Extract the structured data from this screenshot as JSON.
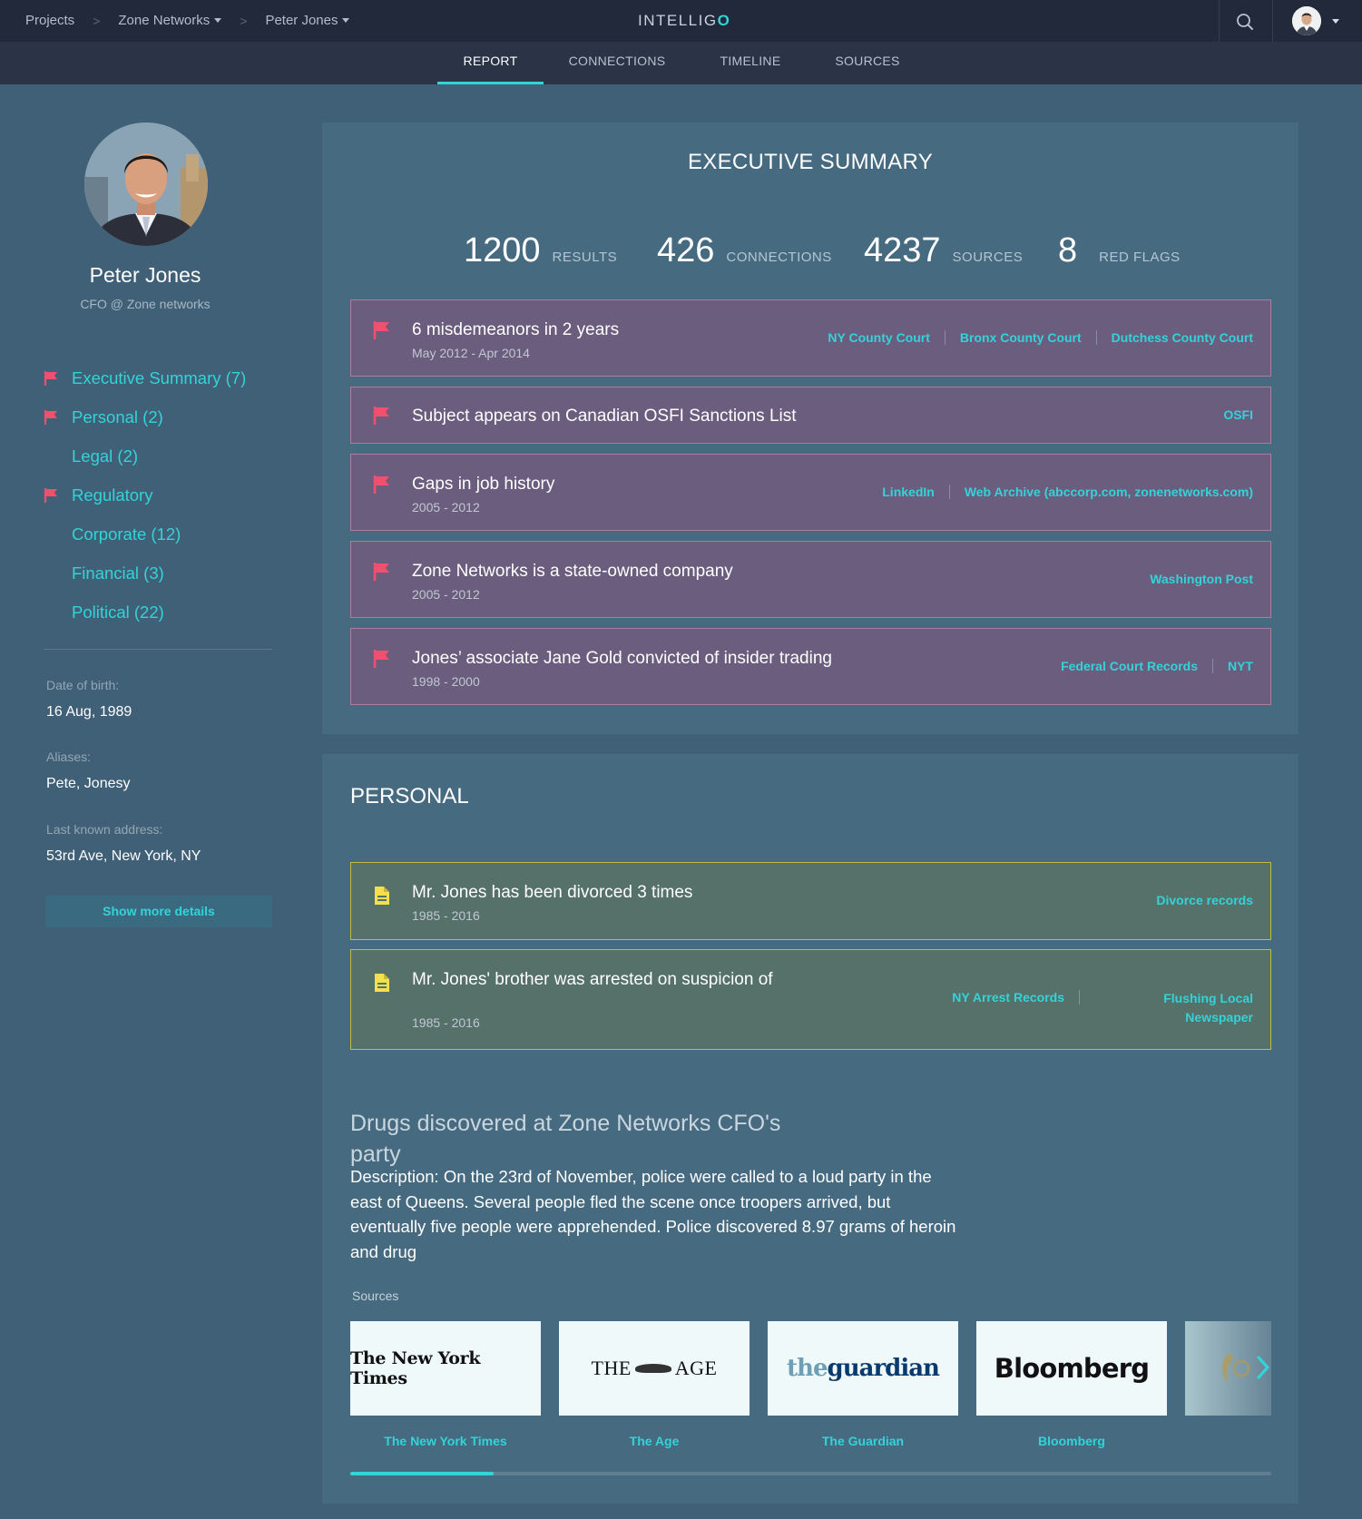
{
  "breadcrumb": {
    "items": [
      {
        "label": "Projects",
        "dropdown": false
      },
      {
        "label": "Zone Networks",
        "dropdown": true
      },
      {
        "label": "Peter Jones",
        "dropdown": true
      }
    ],
    "separator": ">"
  },
  "brand": {
    "prefix": "INTELLIG",
    "accent_letter": "O"
  },
  "header": {
    "search_icon": "search-icon",
    "avatar_icon": "user-avatar-icon"
  },
  "tabs": [
    {
      "label": "REPORT",
      "active": true
    },
    {
      "label": "CONNECTIONS",
      "active": false
    },
    {
      "label": "TIMELINE",
      "active": false
    },
    {
      "label": "SOURCES",
      "active": false
    }
  ],
  "profile": {
    "name": "Peter Jones",
    "role": "CFO @ Zone networks",
    "details": [
      {
        "label": "Date of birth:",
        "value": "16 Aug, 1989"
      },
      {
        "label": "Aliases:",
        "value": "Pete, Jonesy"
      },
      {
        "label": "Last known address:",
        "value": "53rd Ave, New York, NY"
      }
    ],
    "show_more_label": "Show more details"
  },
  "sidebar": {
    "items": [
      {
        "label": "Executive Summary (7)",
        "flagged": true
      },
      {
        "label": "Personal (2)",
        "flagged": true
      },
      {
        "label": "Legal (2)",
        "flagged": false
      },
      {
        "label": "Regulatory",
        "flagged": true
      },
      {
        "label": "Corporate (12)",
        "flagged": false
      },
      {
        "label": "Financial (3)",
        "flagged": false
      },
      {
        "label": "Political (22)",
        "flagged": false
      }
    ]
  },
  "executive_summary": {
    "title": "EXECUTIVE SUMMARY",
    "stats": [
      {
        "value": "1200",
        "label": "RESULTS"
      },
      {
        "value": "426",
        "label": "CONNECTIONS"
      },
      {
        "value": "4237",
        "label": "SOURCES"
      },
      {
        "value": "8",
        "label": "RED FLAGS"
      }
    ],
    "flags": [
      {
        "title": "6 misdemeanors in 2 years",
        "date": "May 2012 - Apr 2014",
        "sources": [
          "NY County Court",
          "Bronx County Court",
          "Dutchess County Court"
        ]
      },
      {
        "title": "Subject appears on Canadian OSFI Sanctions List",
        "date": "",
        "sources": [
          "OSFI"
        ]
      },
      {
        "title": "Gaps in job history",
        "date": "2005 - 2012",
        "sources": [
          "LinkedIn",
          "Web Archive (abccorp.com, zonenetworks.com)"
        ]
      },
      {
        "title": "Zone Networks is a state-owned company",
        "date": "2005 - 2012",
        "sources": [
          "Washington Post"
        ]
      },
      {
        "title": "Jones’ associate Jane Gold convicted of insider trading",
        "date": "1998 - 2000",
        "sources": [
          "Federal Court Records",
          "NYT"
        ]
      }
    ],
    "flag_icon": "red-flag-icon"
  },
  "personal": {
    "title": "PERSONAL",
    "items": [
      {
        "title": "Mr. Jones has been divorced 3 times",
        "date": "1985 - 2016",
        "sources": [
          "Divorce records"
        ]
      },
      {
        "title": "Mr. Jones' brother was arrested on suspicion of",
        "date": "1985 - 2016",
        "sources": [
          "NY Arrest Records",
          "Flushing Local Newspaper"
        ]
      }
    ],
    "doc_icon": "document-icon",
    "article": {
      "title": "Drugs discovered at Zone Networks CFO's party",
      "description": "Description: On the 23rd of November, police were called to a loud party in the east of Queens. Several people fled the scene once troopers arrived, but eventually five people were apprehended. Police discovered 8.97 grams of heroin and drug"
    },
    "sources_label": "Sources",
    "sources": [
      {
        "name": "The New York Times",
        "logo_text": "The New York Times"
      },
      {
        "name": "The Age",
        "logo_text_left": "THE",
        "logo_text_right": "AGE"
      },
      {
        "name": "The Guardian",
        "logo_text_left": "the",
        "logo_text_right": "guardian"
      },
      {
        "name": "Bloomberg",
        "logo_text": "Bloomberg"
      }
    ],
    "scroll_progress": 0.156,
    "next_icon": "chevron-right-icon"
  },
  "colors": {
    "accent": "#33d3d8",
    "flag_red": "#f0506e",
    "doc_yellow": "#f4e04d",
    "top_bar": "#22293a",
    "background": "#3f6077"
  }
}
